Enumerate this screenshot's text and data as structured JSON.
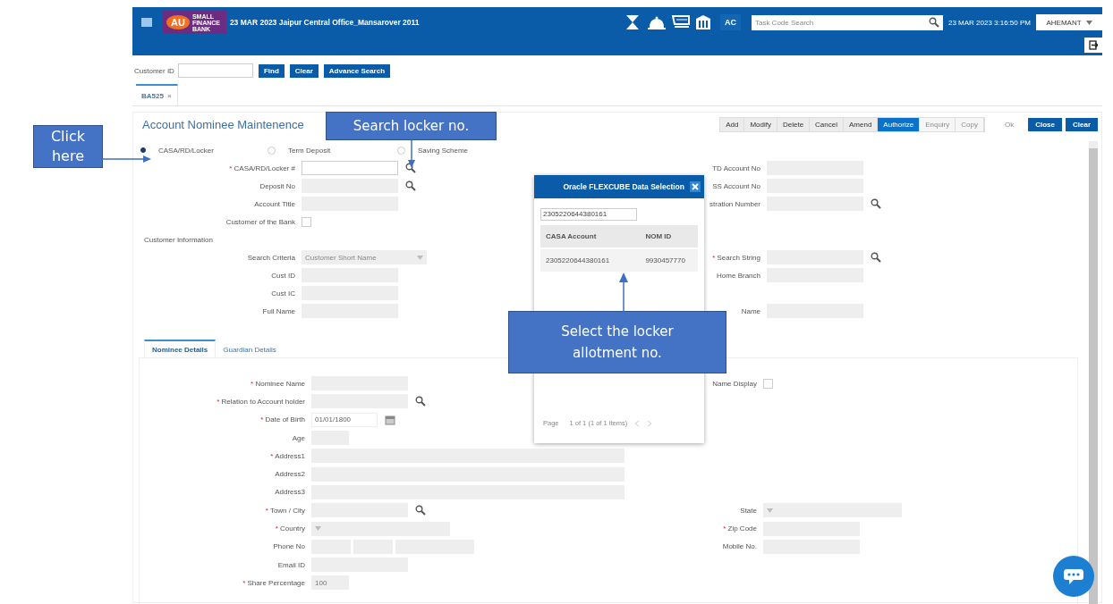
{
  "header": {
    "logo": {
      "mark": "AU",
      "name": "SMALL FINANCE BANK"
    },
    "branch_info": "23 MAR 2023  Jaipur Central Office_Mansarover  2011",
    "user_badge": "AC",
    "task_search": {
      "placeholder": "Task Code Search"
    },
    "datetime": "23 MAR 2023 3:16:50 PM",
    "user": "AHEMANT"
  },
  "customer_search": {
    "label": "Customer ID",
    "buttons": [
      "Find",
      "Clear",
      "Advance Search"
    ]
  },
  "tabs": [
    {
      "label": "BA525",
      "close": "×",
      "selected": true
    }
  ],
  "screen": {
    "title": "Account Nominee Maintenence",
    "actions": [
      {
        "label": "Add",
        "kind": "plain"
      },
      {
        "label": "Modify",
        "kind": "plain"
      },
      {
        "label": "Delete",
        "kind": "plain"
      },
      {
        "label": "Cancel",
        "kind": "plain"
      },
      {
        "label": "Amend",
        "kind": "plain"
      },
      {
        "label": "Authorize",
        "kind": "active"
      },
      {
        "label": "Enquiry",
        "kind": "disabled"
      },
      {
        "label": "Copy",
        "kind": "disabled"
      }
    ],
    "dialog_buttons": [
      {
        "label": "Ok",
        "kind": "disabled"
      },
      {
        "label": "Close",
        "kind": "primary"
      },
      {
        "label": "Clear",
        "kind": "primary"
      }
    ]
  },
  "account_types": [
    {
      "label": "CASA/RD/Locker",
      "selected": true
    },
    {
      "label": "Term Deposit",
      "selected": false
    },
    {
      "label": "Saving Scheme",
      "selected": false
    }
  ],
  "account_rows": [
    {
      "left": {
        "label": "CASA/RD/Locker #",
        "required_mark": "*",
        "kind": "text",
        "editable": true,
        "lookup": true
      },
      "right": {
        "label": "TD Account No",
        "kind": "text",
        "editable": false
      }
    },
    {
      "left": {
        "label": "Deposit No",
        "kind": "text",
        "editable": false,
        "lookup": true
      },
      "right": {
        "label": "SS Account No",
        "kind": "text",
        "editable": false
      }
    },
    {
      "left": {
        "label": "Account Title",
        "kind": "text",
        "editable": false
      },
      "right": {
        "label": "stration Number",
        "kind": "text",
        "editable": false,
        "lookup": true
      }
    },
    {
      "left": {
        "label": "Customer of the Bank",
        "kind": "checkbox",
        "checked": false
      }
    },
    {
      "left": {
        "label": "Customer Information",
        "kind": "heading"
      }
    },
    {
      "left": {
        "label": "Search Criteria",
        "kind": "select",
        "value": "Customer Short Name"
      },
      "right": {
        "label": "Search String",
        "required_mark": "*",
        "kind": "text",
        "editable": false,
        "lookup": true
      }
    },
    {
      "left": {
        "label": "Cust ID",
        "kind": "text",
        "editable": false
      },
      "right": {
        "label": "Home Branch",
        "kind": "text",
        "editable": false
      }
    },
    {
      "left": {
        "label": "Cust IC",
        "kind": "text",
        "editable": false
      }
    },
    {
      "left": {
        "label": "Full Name",
        "kind": "text",
        "editable": false
      },
      "right": {
        "label": "Name",
        "kind": "text",
        "editable": false
      }
    }
  ],
  "detail_tabs": [
    {
      "label": "Nominee Details",
      "selected": true
    },
    {
      "label": "Guardian Details",
      "selected": false
    }
  ],
  "nominee_rows": [
    {
      "left": {
        "label": "Nominee Name",
        "required_mark": "*",
        "kind": "text",
        "editable": false
      },
      "right": {
        "label": "Name Display",
        "kind": "checkbox",
        "checked": false
      }
    },
    {
      "left": {
        "label": "Relation to Account holder",
        "required_mark": "*",
        "kind": "text",
        "editable": false,
        "lookup": true
      }
    },
    {
      "left": {
        "label": "Date of Birth",
        "required_mark": "*",
        "kind": "date",
        "value": "01/01/1800"
      }
    },
    {
      "left": {
        "label": "Age",
        "kind": "short",
        "editable": false
      }
    },
    {
      "left": {
        "label": "Address1",
        "required_mark": "*",
        "kind": "wide",
        "editable": false
      }
    },
    {
      "left": {
        "label": "Address2",
        "kind": "wide",
        "editable": false
      }
    },
    {
      "left": {
        "label": "Address3",
        "kind": "wide",
        "editable": false
      }
    },
    {
      "left": {
        "label": "Town / City",
        "required_mark": "*",
        "kind": "text",
        "editable": false,
        "lookup": true
      },
      "right": {
        "label": "State",
        "kind": "select"
      }
    },
    {
      "left": {
        "label": "Country",
        "required_mark": "*",
        "kind": "select"
      },
      "right": {
        "label": "Zip Code",
        "required_mark": "*",
        "kind": "text",
        "editable": false
      }
    },
    {
      "left": {
        "label": "Phone No",
        "kind": "phone"
      },
      "right": {
        "label": "Mobile No.",
        "kind": "text",
        "editable": false
      }
    },
    {
      "left": {
        "label": "Email ID",
        "kind": "text",
        "editable": false
      }
    },
    {
      "left": {
        "label": "Share Percentage",
        "required_mark": "*",
        "kind": "short",
        "editable": false,
        "value": "100"
      }
    }
  ],
  "lookup_dialog": {
    "title": "Oracle FLEXCUBE Data Selection",
    "search_value": "2305220644380161",
    "columns": [
      "CASA Account",
      "NOM ID"
    ],
    "rows": [
      [
        "2305220644380161",
        "9930457770"
      ]
    ],
    "pager": {
      "label": "Page",
      "info": "1 of 1  (1 of 1 items)"
    }
  },
  "callouts": [
    {
      "text": "Click here",
      "kind": "side"
    },
    {
      "text": "Search locker no.",
      "kind": "top"
    },
    {
      "text": "Select the locker allotment no.",
      "kind": "bottom"
    }
  ]
}
